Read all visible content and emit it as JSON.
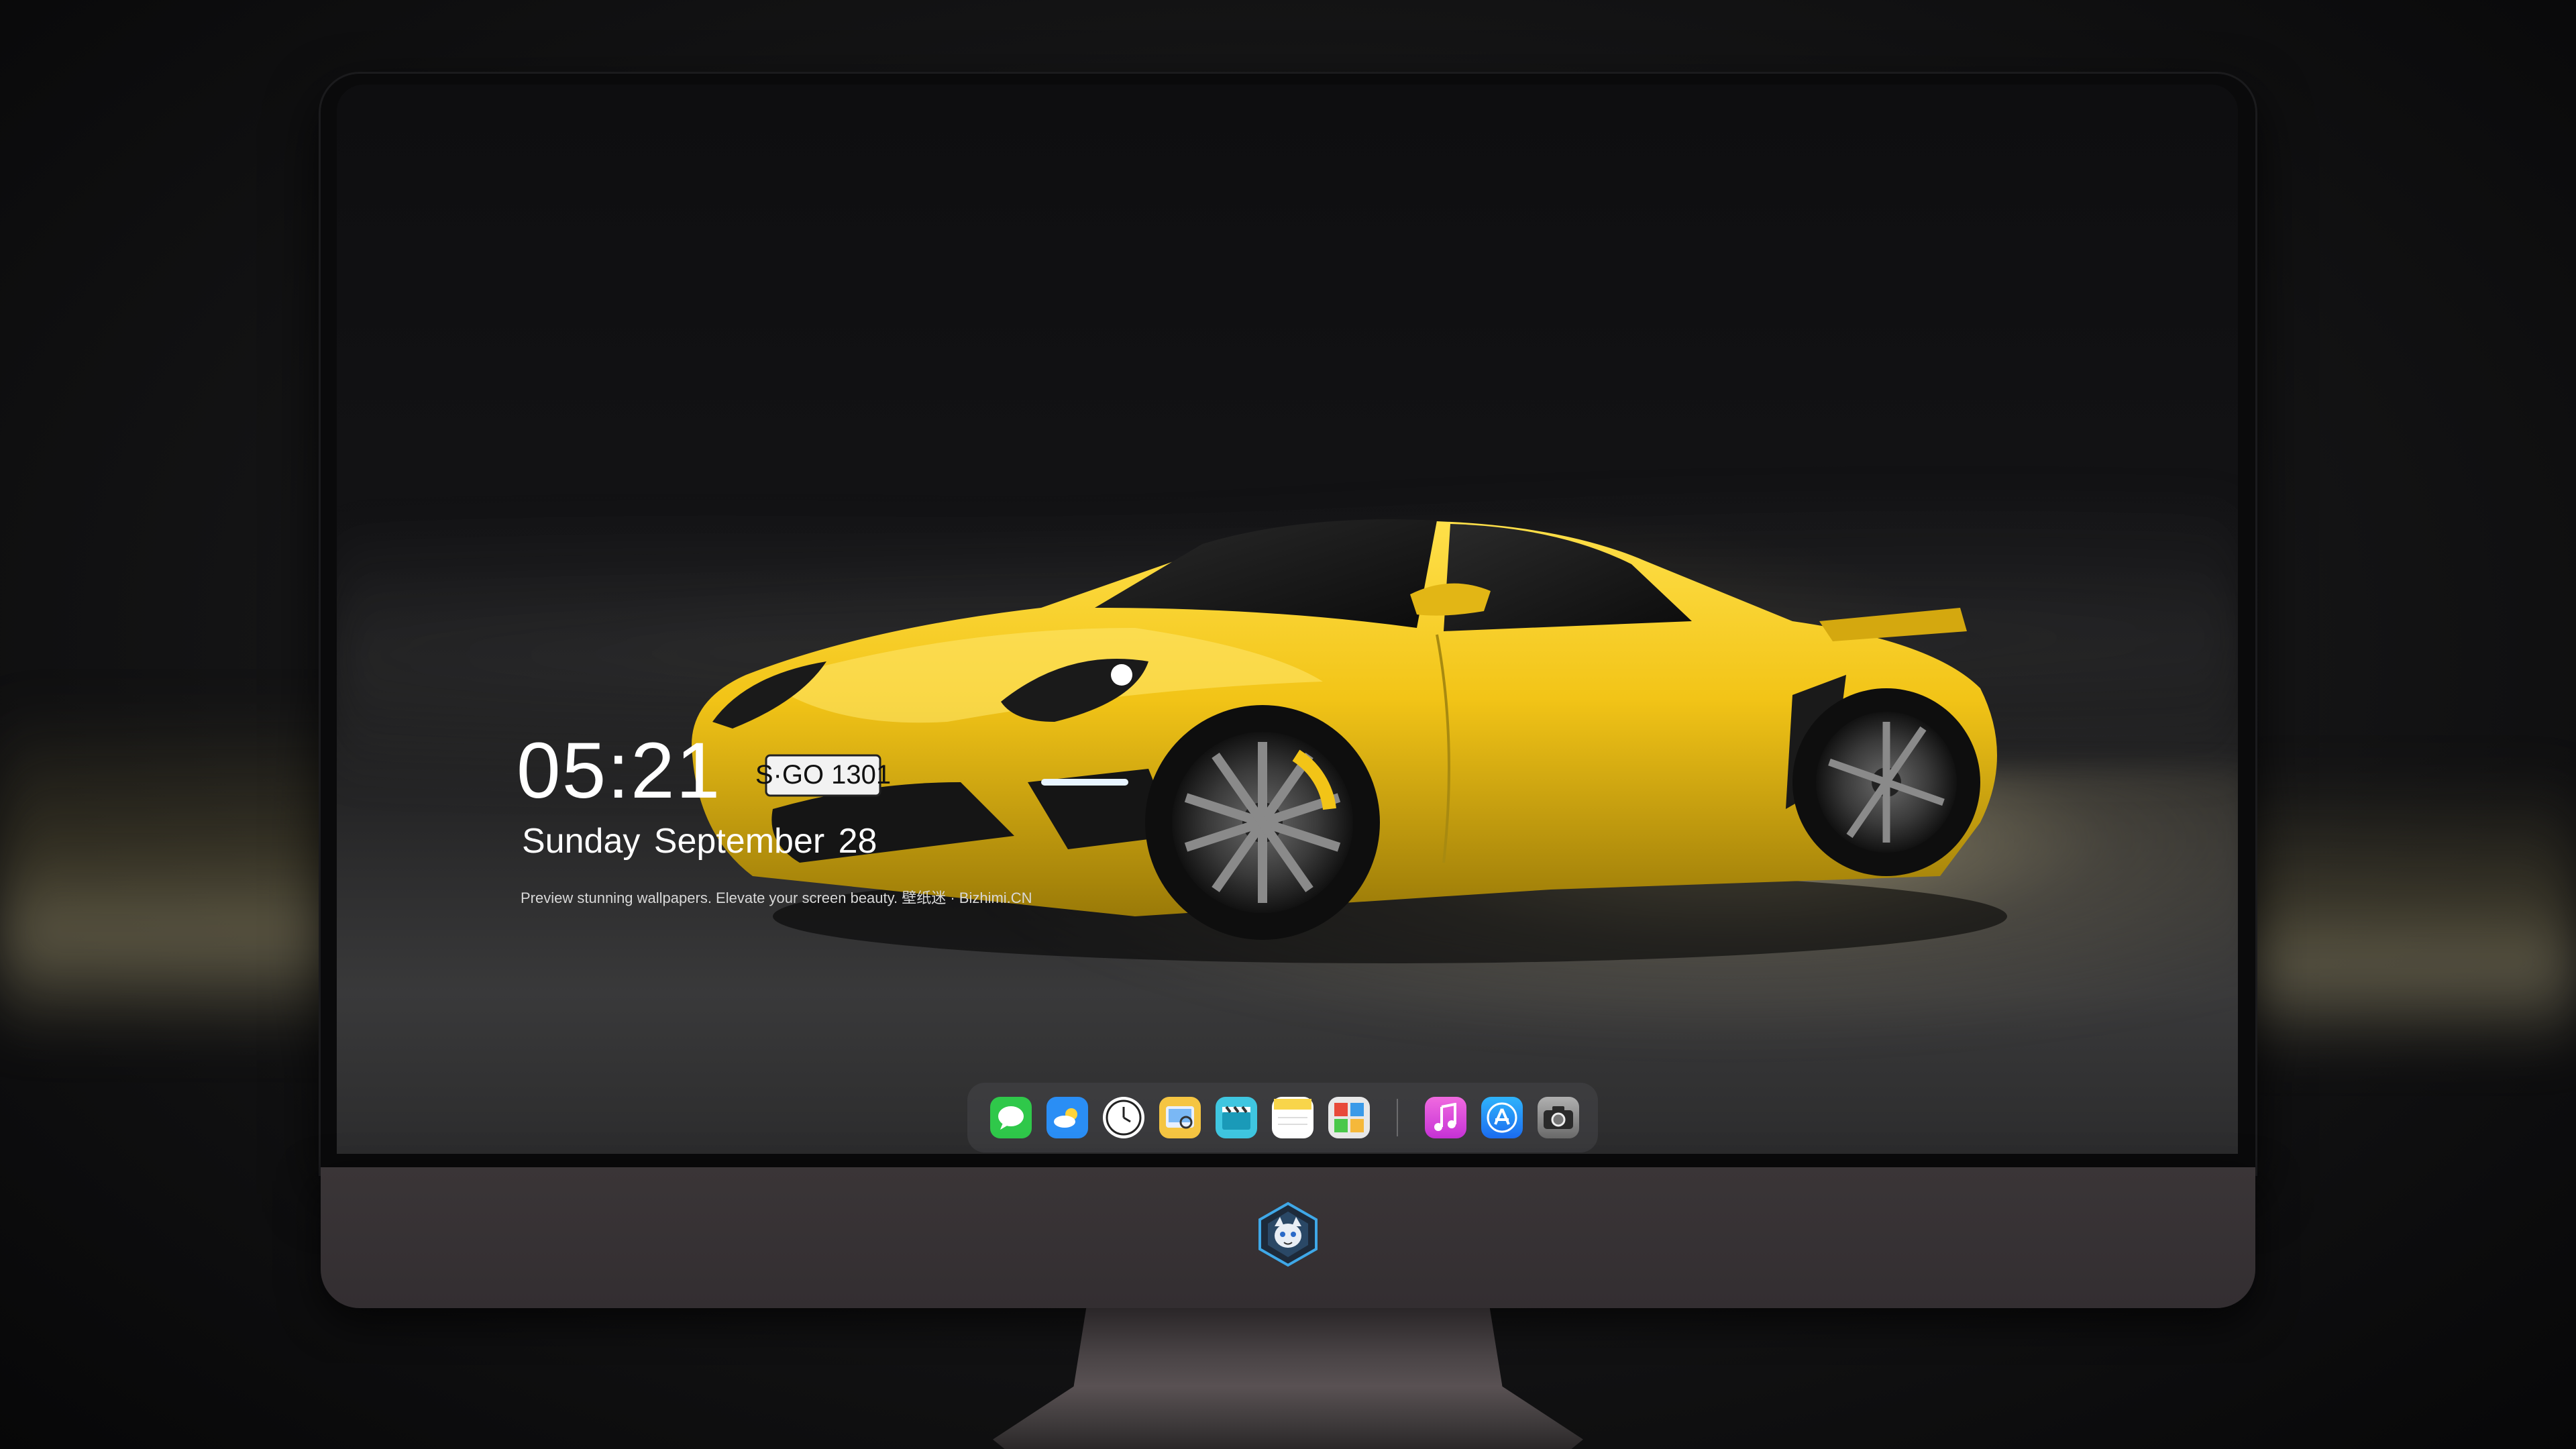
{
  "lockscreen": {
    "time": "05:21",
    "date_weekday_month": "Sunday September",
    "date_day": "28",
    "caption": "Preview stunning wallpapers. Elevate your screen beauty. 壁纸迷 · Bizhimi.CN"
  },
  "wallpaper": {
    "license_plate": "S·GO 1301",
    "car_color": "#f2c417"
  },
  "dock": {
    "apps": [
      {
        "icon": "messages-icon",
        "color": "#2fc84a"
      },
      {
        "icon": "weather-icon",
        "color": "#2a8ef5"
      },
      {
        "icon": "clock-icon",
        "color": "#ffffff"
      },
      {
        "icon": "preview-icon",
        "color": "#f5c542"
      },
      {
        "icon": "clips-icon",
        "color": "#3fc6e0"
      },
      {
        "icon": "notes-icon",
        "color": "#f8d54a"
      },
      {
        "icon": "photo-booth-icon",
        "color": "#e8e8e8"
      },
      {
        "icon": "music-icon",
        "color": "#e040d8"
      },
      {
        "icon": "app-store-icon",
        "color": "#1c8ef8"
      },
      {
        "icon": "camera-icon",
        "color": "#9a9a9a"
      }
    ]
  },
  "branding": {
    "logo": "wolf-mascot-logo"
  }
}
